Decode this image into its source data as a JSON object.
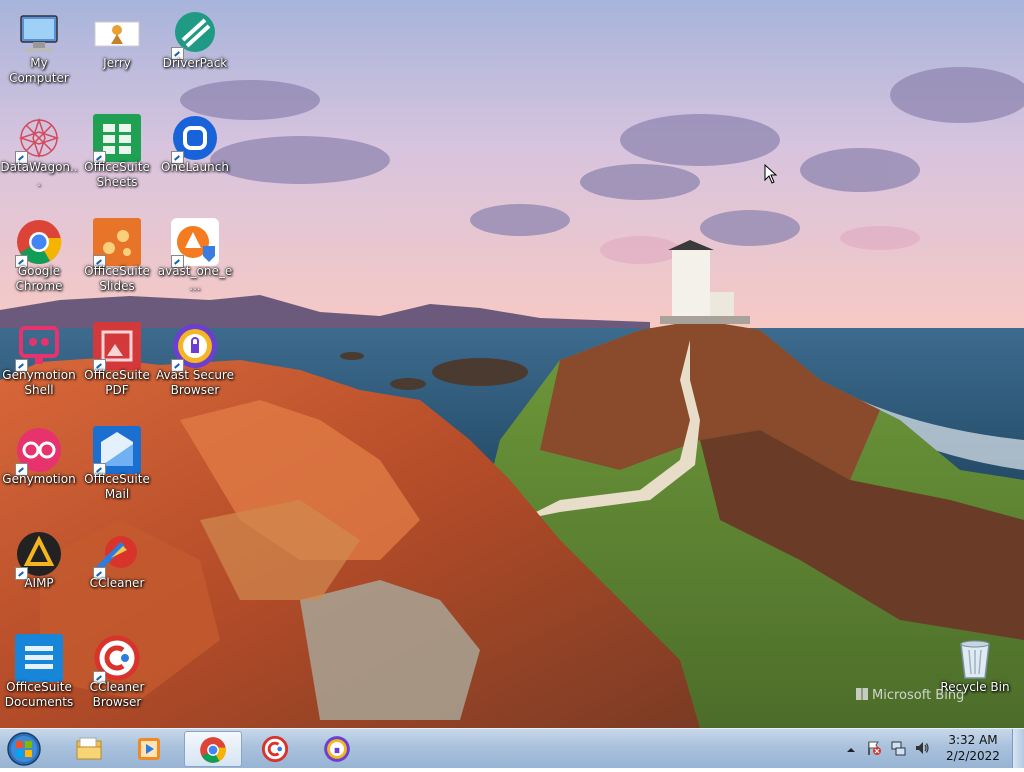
{
  "desktop_icons": [
    {
      "label": "My Computer"
    },
    {
      "label": "Jerry"
    },
    {
      "label": "DriverPack"
    },
    {
      "label": "DataWagon..."
    },
    {
      "label": "OfficeSuite Sheets"
    },
    {
      "label": "OneLaunch"
    },
    {
      "label": "Google Chrome"
    },
    {
      "label": "OfficeSuite Slides"
    },
    {
      "label": "avast_one_e..."
    },
    {
      "label": "Genymotion Shell"
    },
    {
      "label": "OfficeSuite PDF"
    },
    {
      "label": "Avast Secure Browser"
    },
    {
      "label": "Genymotion"
    },
    {
      "label": "OfficeSuite Mail"
    },
    {
      "label": "AIMP"
    },
    {
      "label": "CCleaner"
    },
    {
      "label": "OfficeSuite Documents"
    },
    {
      "label": "CCleaner Browser"
    },
    {
      "label": "Recycle Bin"
    }
  ],
  "watermark": "Microsoft Bing",
  "taskbar": {
    "start": "start-orb",
    "pinned": [
      "file-explorer-icon",
      "media-player-icon",
      "chrome-icon",
      "ccleaner-browser-icon",
      "avast-secure-browser-icon"
    ],
    "clock_time": "3:32 AM",
    "clock_date": "2/2/2022"
  },
  "colors": {
    "taskbar": "#a9c1dc",
    "sky": "#f3c6cf",
    "sea": "#2d5a7a"
  }
}
